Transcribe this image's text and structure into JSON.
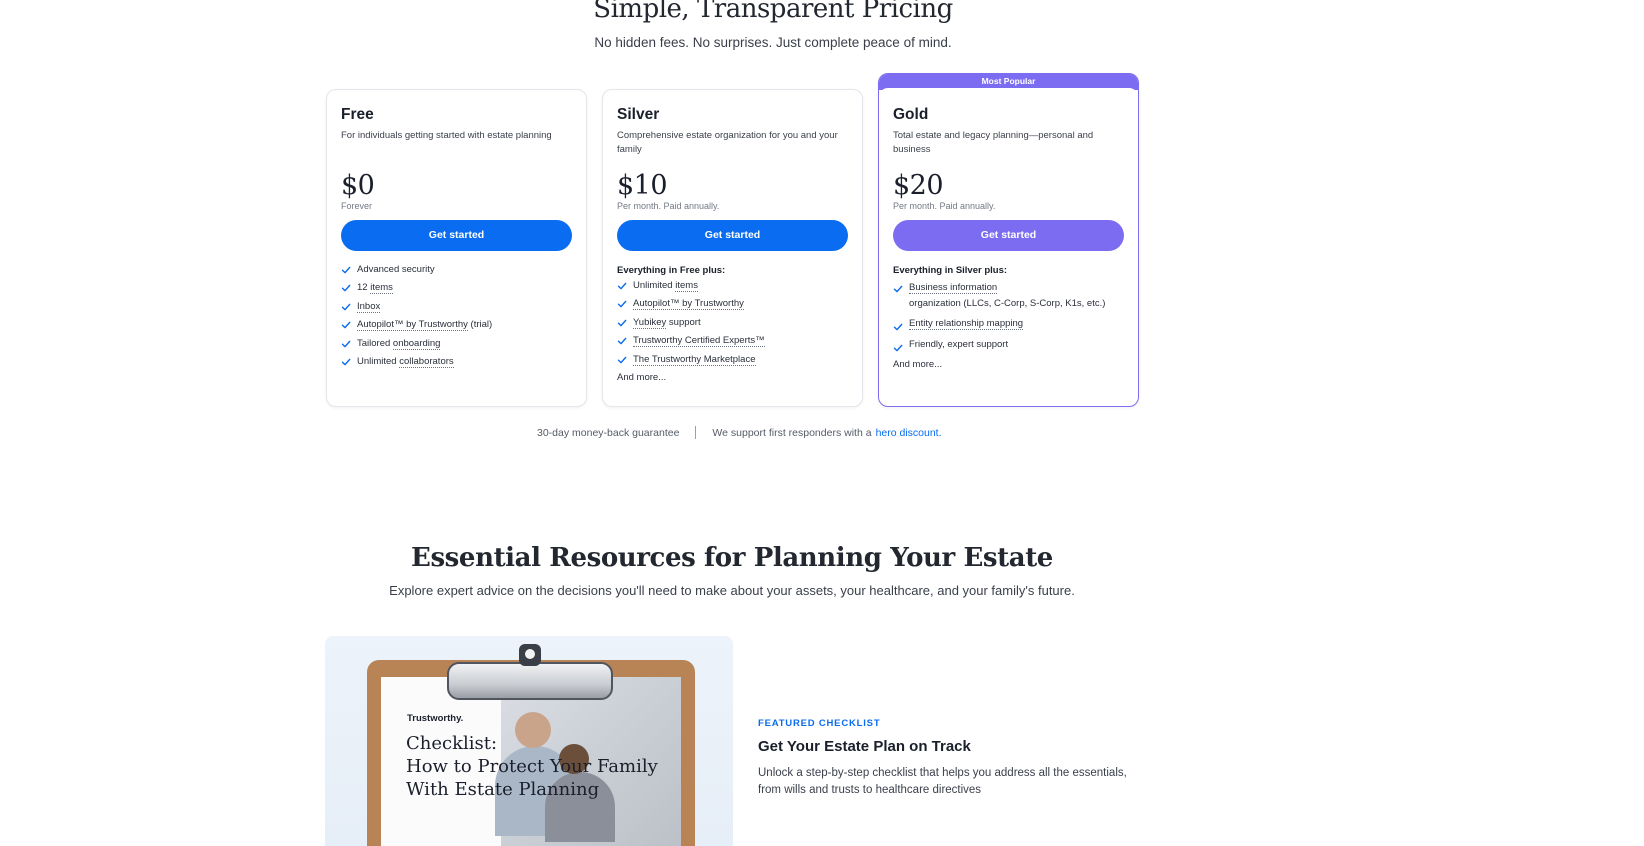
{
  "pricing": {
    "title": "Simple, Transparent Pricing",
    "subtitle": "No hidden fees. No surprises. Just complete peace of mind.",
    "plans": [
      {
        "name": "Free",
        "description": "For individuals getting started with estate planning",
        "price": "$0",
        "period": "Forever",
        "cta": "Get started",
        "features_header": "",
        "features": [
          {
            "pre": "Advanced security",
            "link": "",
            "post": ""
          },
          {
            "pre": "12 ",
            "link": "items",
            "post": ""
          },
          {
            "pre": "",
            "link": "Inbox",
            "post": ""
          },
          {
            "pre": "",
            "link": "Autopilot™ by Trustworthy",
            "post": " (trial)"
          },
          {
            "pre": "Tailored ",
            "link": "onboarding",
            "post": ""
          },
          {
            "pre": "Unlimited ",
            "link": "collaborators",
            "post": ""
          }
        ],
        "more": ""
      },
      {
        "name": "Silver",
        "description": "Comprehensive estate organization for you and your family",
        "price": "$10",
        "period": "Per month. Paid annually.",
        "cta": "Get started",
        "features_header": "Everything in Free plus:",
        "features": [
          {
            "pre": "Unlimited ",
            "link": "items",
            "post": ""
          },
          {
            "pre": "",
            "link": "Autopilot™ by Trustworthy",
            "post": ""
          },
          {
            "pre": "",
            "link": "Yubikey",
            "post": " support"
          },
          {
            "pre": "",
            "link": "Trustworthy Certified Experts™",
            "post": ""
          },
          {
            "pre": "",
            "link": "The Trustworthy Marketplace",
            "post": ""
          }
        ],
        "more": "And more..."
      },
      {
        "name": "Gold",
        "badge": "Most Popular",
        "description": "Total estate and legacy planning—personal and business",
        "price": "$20",
        "period": "Per month. Paid annually.",
        "cta": "Get started",
        "features_header": "Everything in Silver plus:",
        "features": [
          {
            "pre": "",
            "link": "Business information",
            "post": " organization (LLCs, C-Corp, S-Corp, K1s, etc.)"
          },
          {
            "pre": "",
            "link": "Entity relationship mapping",
            "post": ""
          },
          {
            "pre": "Friendly, expert support",
            "link": "",
            "post": ""
          }
        ],
        "more": "And more..."
      }
    ],
    "guarantee": "30-day money-back guarantee",
    "first_responders": "We support first responders with a",
    "hero_link": "hero discount."
  },
  "resources": {
    "title": "Essential Resources for Planning Your Estate",
    "subtitle": "Explore expert advice on the decisions you'll need to make about your assets, your healthcare, and your family's future.",
    "image_brand": "Trustworthy.",
    "image_text": [
      "Checklist:",
      "How to Protect Your Family",
      "With Estate Planning"
    ],
    "featured_label": "FEATURED CHECKLIST",
    "featured_title": "Get Your Estate Plan on Track",
    "featured_description": "Unlock a step-by-step checklist that helps you address all the essentials, from wills and trusts to healthcare directives"
  },
  "colors": {
    "primary_blue": "#0a6cf0",
    "gold_purple": "#7c6cf2",
    "check_blue": "#0a6cf0"
  }
}
